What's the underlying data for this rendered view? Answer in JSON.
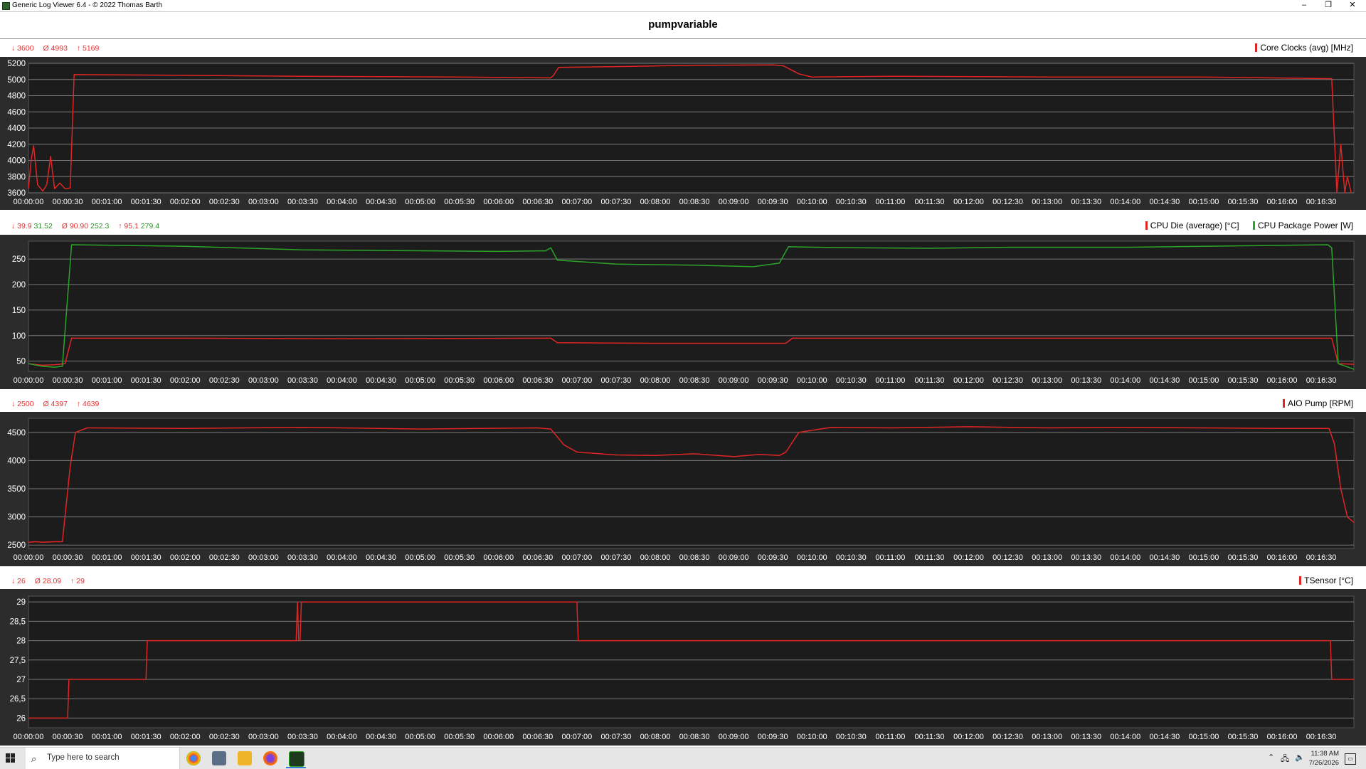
{
  "window": {
    "title": "Generic Log Viewer 6.4 - © 2022 Thomas Barth",
    "controls": [
      "–",
      "❐",
      "✕"
    ]
  },
  "main_title": "pumpvariable",
  "colors": {
    "red": "#e02525",
    "green": "#2aa52a",
    "plot_bg": "#1c1c1c",
    "frame_bg": "#2c2c2c",
    "grid": "#7a7a7a",
    "axis_text": "#ffffff"
  },
  "charts": [
    {
      "stats": {
        "min": "3600",
        "avg": "4993",
        "max": "5169"
      },
      "legend": [
        {
          "label": "Core Clocks (avg) [MHz]",
          "color": "#e02525"
        }
      ],
      "yticks": [
        "5200",
        "5000",
        "4800",
        "4600",
        "4400",
        "4200",
        "4000",
        "3800",
        "3600"
      ],
      "xticks": [
        "00:00:00",
        "00:00:30",
        "00:01:00",
        "00:01:30",
        "00:02:00",
        "00:02:30",
        "00:03:00",
        "00:03:30",
        "00:04:00",
        "00:04:30",
        "00:05:00",
        "00:05:30",
        "00:06:00",
        "00:06:30",
        "00:07:00",
        "00:07:30",
        "00:08:00",
        "00:08:30",
        "00:09:00",
        "00:09:30",
        "00:10:00",
        "00:10:30",
        "00:11:00",
        "00:11:30",
        "00:12:00",
        "00:12:30",
        "00:13:00",
        "00:13:30",
        "00:14:00",
        "00:14:30",
        "00:15:00",
        "00:15:30",
        "00:16:00",
        "00:16:30"
      ]
    },
    {
      "stats": {
        "min": "39.9",
        "min2": "31.52",
        "avg": "90.90",
        "avg2": "252.3",
        "max": "95.1",
        "max2": "279.4"
      },
      "legend": [
        {
          "label": "CPU Die (average) [°C]",
          "color": "#e02525"
        },
        {
          "label": "CPU Package Power [W]",
          "color": "#2aa52a"
        }
      ],
      "yticks": [
        "250",
        "200",
        "150",
        "100",
        "50"
      ],
      "xticks": [
        "00:00:00",
        "00:00:30",
        "00:01:00",
        "00:01:30",
        "00:02:00",
        "00:02:30",
        "00:03:00",
        "00:03:30",
        "00:04:00",
        "00:04:30",
        "00:05:00",
        "00:05:30",
        "00:06:00",
        "00:06:30",
        "00:07:00",
        "00:07:30",
        "00:08:00",
        "00:08:30",
        "00:09:00",
        "00:09:30",
        "00:10:00",
        "00:10:30",
        "00:11:00",
        "00:11:30",
        "00:12:00",
        "00:12:30",
        "00:13:00",
        "00:13:30",
        "00:14:00",
        "00:14:30",
        "00:15:00",
        "00:15:30",
        "00:16:00",
        "00:16:30"
      ]
    },
    {
      "stats": {
        "min": "2500",
        "avg": "4397",
        "max": "4639"
      },
      "legend": [
        {
          "label": "AIO Pump [RPM]",
          "color": "#e02525"
        }
      ],
      "yticks": [
        "4500",
        "4000",
        "3500",
        "3000",
        "2500"
      ],
      "xticks": [
        "00:00:00",
        "00:00:30",
        "00:01:00",
        "00:01:30",
        "00:02:00",
        "00:02:30",
        "00:03:00",
        "00:03:30",
        "00:04:00",
        "00:04:30",
        "00:05:00",
        "00:05:30",
        "00:06:00",
        "00:06:30",
        "00:07:00",
        "00:07:30",
        "00:08:00",
        "00:08:30",
        "00:09:00",
        "00:09:30",
        "00:10:00",
        "00:10:30",
        "00:11:00",
        "00:11:30",
        "00:12:00",
        "00:12:30",
        "00:13:00",
        "00:13:30",
        "00:14:00",
        "00:14:30",
        "00:15:00",
        "00:15:30",
        "00:16:00",
        "00:16:30"
      ]
    },
    {
      "stats": {
        "min": "26",
        "avg": "28.09",
        "max": "29"
      },
      "legend": [
        {
          "label": "TSensor [°C]",
          "color": "#e02525"
        }
      ],
      "yticks": [
        "29",
        "28,5",
        "28",
        "27,5",
        "27",
        "26,5",
        "26"
      ],
      "xticks": [
        "00:00:00",
        "00:00:30",
        "00:01:00",
        "00:01:30",
        "00:02:00",
        "00:02:30",
        "00:03:00",
        "00:03:30",
        "00:04:00",
        "00:04:30",
        "00:05:00",
        "00:05:30",
        "00:06:00",
        "00:06:30",
        "00:07:00",
        "00:07:30",
        "00:08:00",
        "00:08:30",
        "00:09:00",
        "00:09:30",
        "00:10:00",
        "00:10:30",
        "00:11:00",
        "00:11:30",
        "00:12:00",
        "00:12:30",
        "00:13:00",
        "00:13:30",
        "00:14:00",
        "00:14:30",
        "00:15:00",
        "00:15:30",
        "00:16:00",
        "00:16:30"
      ]
    }
  ],
  "chart_data": [
    {
      "type": "line",
      "xlabel": "",
      "ylabel": "",
      "ylim": [
        3600,
        5200
      ],
      "grid": true,
      "legend_position": "top-right",
      "series": [
        {
          "name": "Core Clocks (avg) [MHz]",
          "color": "#e02525",
          "points": [
            [
              "00:00:00",
              3650
            ],
            [
              "00:00:02",
              4000
            ],
            [
              "00:00:04",
              4180
            ],
            [
              "00:00:07",
              3700
            ],
            [
              "00:00:11",
              3620
            ],
            [
              "00:00:14",
              3700
            ],
            [
              "00:00:17",
              4050
            ],
            [
              "00:00:20",
              3650
            ],
            [
              "00:00:24",
              3720
            ],
            [
              "00:00:28",
              3650
            ],
            [
              "00:00:32",
              3660
            ],
            [
              "00:00:35",
              5060
            ],
            [
              "00:01:30",
              5055
            ],
            [
              "00:03:30",
              5040
            ],
            [
              "00:05:30",
              5030
            ],
            [
              "00:06:40",
              5020
            ],
            [
              "00:06:42",
              5050
            ],
            [
              "00:06:46",
              5150
            ],
            [
              "00:07:30",
              5160
            ],
            [
              "00:08:30",
              5175
            ],
            [
              "00:09:30",
              5180
            ],
            [
              "00:09:38",
              5170
            ],
            [
              "00:09:50",
              5070
            ],
            [
              "00:10:00",
              5030
            ],
            [
              "00:11:00",
              5040
            ],
            [
              "00:13:00",
              5030
            ],
            [
              "00:15:00",
              5030
            ],
            [
              "00:16:38",
              5010
            ],
            [
              "00:16:40",
              4300
            ],
            [
              "00:16:42",
              3600
            ],
            [
              "00:16:45",
              4200
            ],
            [
              "00:16:48",
              3600
            ],
            [
              "00:16:50",
              3800
            ],
            [
              "00:16:53",
              3600
            ]
          ]
        }
      ]
    },
    {
      "type": "line",
      "xlabel": "",
      "ylabel": "",
      "ylim": [
        30,
        285
      ],
      "grid": true,
      "legend_position": "top-right",
      "series": [
        {
          "name": "CPU Die (average) [°C]",
          "color": "#e02525",
          "points": [
            [
              "00:00:00",
              45
            ],
            [
              "00:00:10",
              42
            ],
            [
              "00:00:20",
              43
            ],
            [
              "00:00:28",
              45
            ],
            [
              "00:00:33",
              95
            ],
            [
              "00:02:00",
              95
            ],
            [
              "00:04:00",
              94
            ],
            [
              "00:06:40",
              95
            ],
            [
              "00:06:45",
              86
            ],
            [
              "00:08:00",
              85
            ],
            [
              "00:09:40",
              85
            ],
            [
              "00:09:45",
              95
            ],
            [
              "00:12:00",
              95
            ],
            [
              "00:14:00",
              95
            ],
            [
              "00:16:38",
              95
            ],
            [
              "00:16:43",
              45
            ],
            [
              "00:16:55",
              44
            ]
          ]
        },
        {
          "name": "CPU Package Power [W]",
          "color": "#2aa52a",
          "points": [
            [
              "00:00:00",
              45
            ],
            [
              "00:00:10",
              40
            ],
            [
              "00:00:20",
              38
            ],
            [
              "00:00:26",
              40
            ],
            [
              "00:00:33",
              278
            ],
            [
              "00:02:00",
              275
            ],
            [
              "00:03:30",
              268
            ],
            [
              "00:06:00",
              265
            ],
            [
              "00:06:36",
              266
            ],
            [
              "00:06:40",
              272
            ],
            [
              "00:06:45",
              248
            ],
            [
              "00:07:30",
              240
            ],
            [
              "00:08:30",
              238
            ],
            [
              "00:09:15",
              235
            ],
            [
              "00:09:35",
              242
            ],
            [
              "00:09:42",
              274
            ],
            [
              "00:10:30",
              272
            ],
            [
              "00:11:30",
              271
            ],
            [
              "00:12:30",
              273
            ],
            [
              "00:14:00",
              273
            ],
            [
              "00:16:35",
              278
            ],
            [
              "00:16:38",
              272
            ],
            [
              "00:16:43",
              45
            ],
            [
              "00:16:55",
              34
            ]
          ]
        }
      ]
    },
    {
      "type": "line",
      "xlabel": "",
      "ylabel": "",
      "ylim": [
        2440,
        4750
      ],
      "grid": true,
      "legend_position": "top-right",
      "series": [
        {
          "name": "AIO Pump [RPM]",
          "color": "#e02525",
          "points": [
            [
              "00:00:00",
              2550
            ],
            [
              "00:00:05",
              2560
            ],
            [
              "00:00:10",
              2550
            ],
            [
              "00:00:20",
              2560
            ],
            [
              "00:00:26",
              2560
            ],
            [
              "00:00:32",
              3900
            ],
            [
              "00:00:36",
              4500
            ],
            [
              "00:00:45",
              4580
            ],
            [
              "00:02:00",
              4570
            ],
            [
              "00:03:30",
              4590
            ],
            [
              "00:05:00",
              4560
            ],
            [
              "00:06:30",
              4580
            ],
            [
              "00:06:40",
              4560
            ],
            [
              "00:06:50",
              4280
            ],
            [
              "00:07:00",
              4150
            ],
            [
              "00:07:30",
              4100
            ],
            [
              "00:08:00",
              4090
            ],
            [
              "00:08:30",
              4120
            ],
            [
              "00:09:00",
              4070
            ],
            [
              "00:09:20",
              4110
            ],
            [
              "00:09:35",
              4090
            ],
            [
              "00:09:40",
              4150
            ],
            [
              "00:09:50",
              4500
            ],
            [
              "00:10:15",
              4590
            ],
            [
              "00:11:00",
              4580
            ],
            [
              "00:12:00",
              4600
            ],
            [
              "00:13:00",
              4580
            ],
            [
              "00:14:00",
              4590
            ],
            [
              "00:15:00",
              4580
            ],
            [
              "00:16:00",
              4570
            ],
            [
              "00:16:36",
              4570
            ],
            [
              "00:16:40",
              4300
            ],
            [
              "00:16:45",
              3500
            ],
            [
              "00:16:50",
              3000
            ],
            [
              "00:16:55",
              2900
            ]
          ]
        }
      ]
    },
    {
      "type": "line",
      "xlabel": "",
      "ylabel": "",
      "ylim": [
        25.75,
        29.15
      ],
      "grid": true,
      "legend_position": "top-right",
      "series": [
        {
          "name": "TSensor [°C]",
          "color": "#e02525",
          "points": [
            [
              "00:00:00",
              26
            ],
            [
              "00:00:30",
              26
            ],
            [
              "00:00:31",
              27
            ],
            [
              "00:01:30",
              27
            ],
            [
              "00:01:31",
              28
            ],
            [
              "00:03:25",
              28
            ],
            [
              "00:03:26",
              29
            ],
            [
              "00:03:27",
              28
            ],
            [
              "00:03:28",
              28
            ],
            [
              "00:03:29",
              29
            ],
            [
              "00:07:00",
              29
            ],
            [
              "00:07:01",
              28
            ],
            [
              "00:16:37",
              28
            ],
            [
              "00:16:38",
              27
            ],
            [
              "00:16:55",
              27
            ]
          ]
        }
      ]
    }
  ],
  "taskbar": {
    "search_placeholder": "Type here to search",
    "clock_time": "11:38 AM",
    "clock_date": "7/26/2026"
  }
}
